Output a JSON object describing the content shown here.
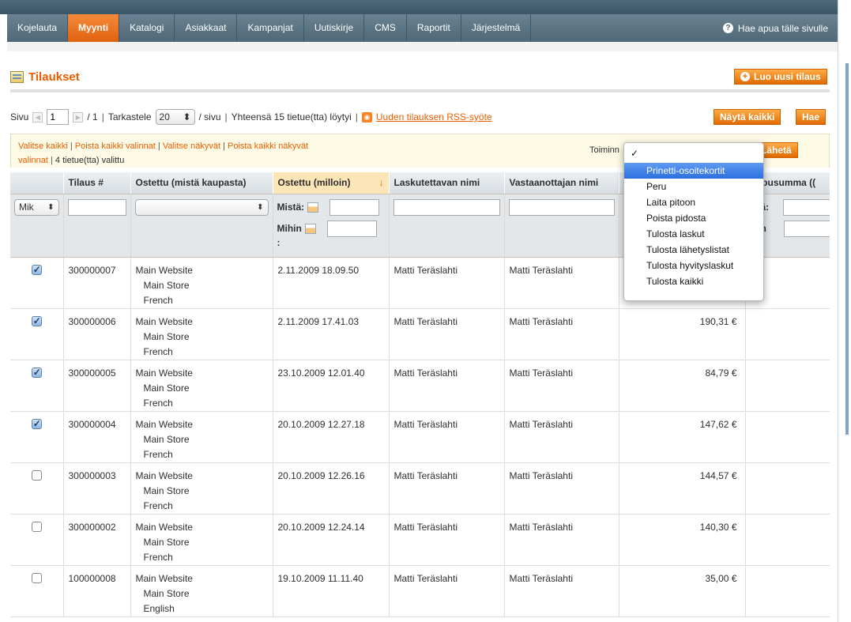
{
  "nav": {
    "items": [
      "Kojelauta",
      "Myynti",
      "Katalogi",
      "Asiakkaat",
      "Kampanjat",
      "Uutiskirje",
      "CMS",
      "Raportit",
      "Järjestelmä"
    ],
    "active": "Myynti",
    "help": "Hae apua tälle sivulle"
  },
  "header": {
    "title": "Tilaukset",
    "new_order_button": "Luo uusi tilaus"
  },
  "pager": {
    "page_label": "Sivu",
    "page_value": "1",
    "total_pages": "/ 1",
    "view_label": "Tarkastele",
    "per_page": "20",
    "per_page_suffix": "/ sivu",
    "total_text": "Yhteensä 15 tietue(tta) löytyi",
    "rss_link": "Uuden tilauksen RSS-syöte",
    "show_all_button": "Näytä kaikki",
    "search_button": "Hae"
  },
  "massaction": {
    "select_all": "Valitse kaikki",
    "unselect_all": "Poista kaikki valinnat",
    "select_visible": "Valitse näkyvät",
    "unselect_visible_1": "Poista kaikki näkyvät",
    "unselect_visible_2": "valinnat",
    "selected_count": "4 tietue(tta) valittu",
    "actions_label": "Toiminn",
    "submit_button": "Lähetä"
  },
  "dropdown": {
    "checked_blank": "✓",
    "options": [
      "Prinetti-osoitekortit",
      "Peru",
      "Laita pitoon",
      "Poista pidosta",
      "Tulosta laskut",
      "Tulosta lähetyslistat",
      "Tulosta hyvityslaskut",
      "Tulosta kaikki"
    ],
    "highlighted": "Prinetti-osoitekortit"
  },
  "grid": {
    "columns": [
      "",
      "Tilaus #",
      "Ostettu (mistä kaupasta)",
      "Ostettu (milloin)",
      "Laskutettavan nimi",
      "Vastaanottajan nimi",
      "",
      "oppusumma (("
    ],
    "sorted_arrow": "↓",
    "filter": {
      "massaction_select": "Mik",
      "from_label": "Mistä:",
      "to_label": "Mihin",
      "colon": ":",
      "total_from": "istä:",
      "total_to": "ihin"
    },
    "rows": [
      {
        "checked": true,
        "id": "300000007",
        "store": [
          "Main Website",
          "Main Store",
          "French"
        ],
        "date": "2.11.2009 18.09.50",
        "bill": "Matti Teräslahti",
        "ship": "Matti Teräslahti",
        "total": ""
      },
      {
        "checked": true,
        "id": "300000006",
        "store": [
          "Main Website",
          "Main Store",
          "French"
        ],
        "date": "2.11.2009 17.41.03",
        "bill": "Matti Teräslahti",
        "ship": "Matti Teräslahti",
        "total": "190,31 €"
      },
      {
        "checked": true,
        "id": "300000005",
        "store": [
          "Main Website",
          "Main Store",
          "French"
        ],
        "date": "23.10.2009 12.01.40",
        "bill": "Matti Teräslahti",
        "ship": "Matti Teräslahti",
        "total": "84,79 €"
      },
      {
        "checked": true,
        "id": "300000004",
        "store": [
          "Main Website",
          "Main Store",
          "French"
        ],
        "date": "20.10.2009 12.27.18",
        "bill": "Matti Teräslahti",
        "ship": "Matti Teräslahti",
        "total": "147,62 €"
      },
      {
        "checked": false,
        "id": "300000003",
        "store": [
          "Main Website",
          "Main Store",
          "French"
        ],
        "date": "20.10.2009 12.26.16",
        "bill": "Matti Teräslahti",
        "ship": "Matti Teräslahti",
        "total": "144,57 €"
      },
      {
        "checked": false,
        "id": "300000002",
        "store": [
          "Main Website",
          "Main Store",
          "French"
        ],
        "date": "20.10.2009 12.24.14",
        "bill": "Matti Teräslahti",
        "ship": "Matti Teräslahti",
        "total": "140,30 €"
      },
      {
        "checked": false,
        "id": "100000008",
        "store": [
          "Main Website",
          "Main Store",
          "English"
        ],
        "date": "19.10.2009 11.11.40",
        "bill": "Matti Teräslahti",
        "ship": "Matti Teräslahti",
        "total": "35,00 €"
      }
    ]
  },
  "colors": {
    "accent": "#eb5e00",
    "nav_bg": "#5a7383",
    "nav_active": "#ef7a24",
    "dropdown_highlight": "#3b7ee6"
  }
}
